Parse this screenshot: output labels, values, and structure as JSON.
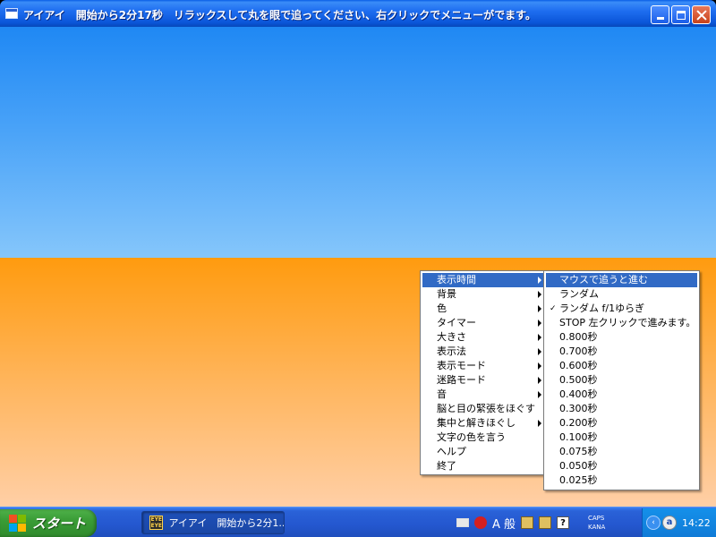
{
  "window": {
    "title": "アイアイ　開始から2分17秒　リラックスして丸を眼で追ってください、右クリックでメニューがでます。"
  },
  "main_menu": {
    "items": [
      {
        "label": "表示時間",
        "submenu": true,
        "highlighted": true
      },
      {
        "label": "背景",
        "submenu": true
      },
      {
        "label": "色",
        "submenu": true
      },
      {
        "label": "タイマー",
        "submenu": true
      },
      {
        "label": "大きさ",
        "submenu": true
      },
      {
        "label": "表示法",
        "submenu": true
      },
      {
        "label": "表示モード",
        "submenu": true
      },
      {
        "label": "迷路モード",
        "submenu": true
      },
      {
        "label": "音",
        "submenu": true
      },
      {
        "label": "脳と目の緊張をほぐす",
        "submenu": false
      },
      {
        "label": "集中と解きほぐし",
        "submenu": true
      },
      {
        "label": "文字の色を言う",
        "submenu": false
      },
      {
        "label": "ヘルプ",
        "submenu": false
      },
      {
        "label": "終了",
        "submenu": false
      }
    ]
  },
  "sub_menu": {
    "items": [
      {
        "label": "マウスで追うと進む",
        "highlighted": true
      },
      {
        "label": "ランダム"
      },
      {
        "label": "ランダム f/1ゆらぎ",
        "checked": true
      },
      {
        "label": "STOP 左クリックで進みます。"
      },
      {
        "label": "0.800秒"
      },
      {
        "label": "0.700秒"
      },
      {
        "label": "0.600秒"
      },
      {
        "label": "0.500秒"
      },
      {
        "label": "0.400秒"
      },
      {
        "label": "0.300秒"
      },
      {
        "label": "0.200秒"
      },
      {
        "label": "0.100秒"
      },
      {
        "label": "0.075秒"
      },
      {
        "label": "0.050秒"
      },
      {
        "label": "0.025秒"
      }
    ],
    "check_glyph": "✓"
  },
  "taskbar": {
    "start_label": "スタート",
    "task_label": "アイアイ　開始から2分1...",
    "task_icon_text": "EYE EYE",
    "ime_text": "A 般",
    "help_glyph": "?",
    "caps_label": "CAPS",
    "kana_label": "KANA",
    "chevron_glyph": "‹",
    "av_glyph": "a",
    "clock": "14:22"
  },
  "colors": {
    "sky_top": "#1f88f4",
    "ground_top": "#ff9b0f",
    "menu_highlight": "#316ac5"
  }
}
